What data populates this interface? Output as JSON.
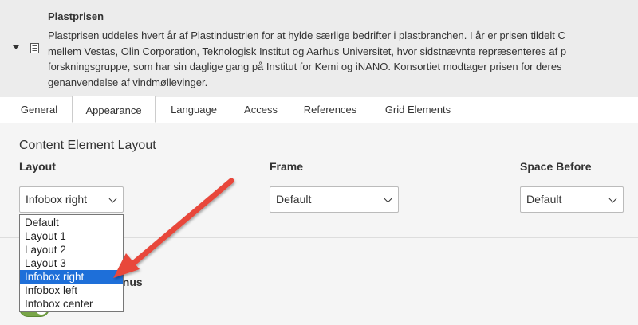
{
  "record": {
    "title": "Plastprisen",
    "body_lines": [
      "Plastprisen uddeles hvert år af Plastindustrien for at hylde særlige bedrifter i plastbranchen. I år er prisen tildelt C",
      "mellem Vestas, Olin Corporation, Teknologisk Institut og Aarhus Universitet, hvor sidstnævnte repræsenteres af p",
      "forskningsgruppe, som har sin daglige gang på Institut for Kemi og iNANO. Konsortiet modtager prisen for deres",
      "genanvendelse af vindmøllevinger."
    ]
  },
  "tabs": [
    "General",
    "Appearance",
    "Language",
    "Access",
    "References",
    "Grid Elements"
  ],
  "active_tab": "Appearance",
  "form": {
    "section_title": "Content Element Layout",
    "layout": {
      "label": "Layout",
      "value": "Infobox right"
    },
    "frame": {
      "label": "Frame",
      "value": "Default"
    },
    "space_before": {
      "label": "Space Before",
      "value": "Default"
    },
    "section2_title_visible": "enus",
    "toggle_on": true
  },
  "dropdown": {
    "options": [
      "Default",
      "Layout 1",
      "Layout 2",
      "Layout 3",
      "Infobox right",
      "Infobox left",
      "Infobox center"
    ],
    "selected": "Infobox right"
  },
  "colors": {
    "header_bg": "#ececec",
    "panel_bg": "#f5f5f5",
    "selected_option": "#1e6fd9",
    "toggle_green": "#79a548",
    "annotation_arrow": "#e8473b"
  },
  "icons": {
    "toggle": "caret-down-icon",
    "record_type": "document-icon",
    "select_chevron": "chevron-down-icon"
  }
}
